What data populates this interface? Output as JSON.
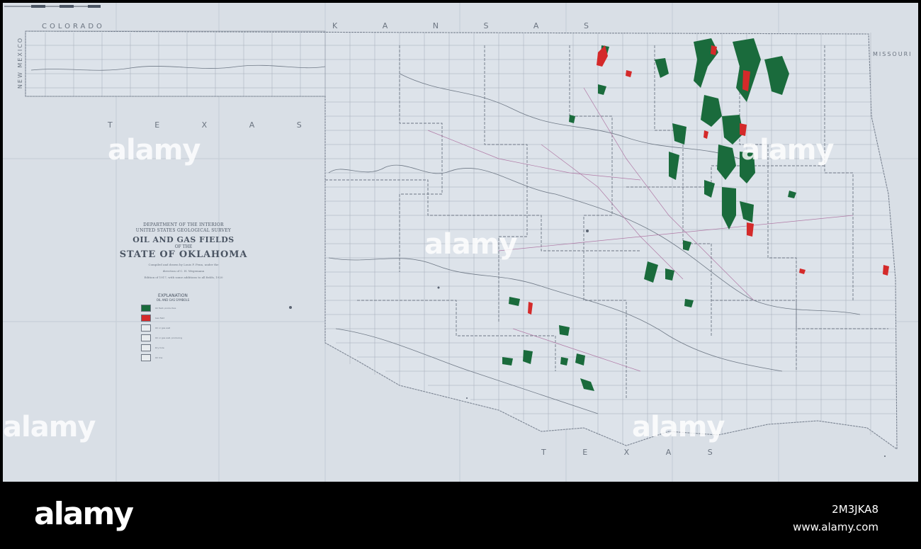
{
  "map": {
    "neighbors": {
      "north_west": "COLORADO",
      "north": "K A N S A S",
      "west_panhandle": "NEW MEXICO",
      "southwest": "T E X A S",
      "south": "T E X A S",
      "east": "MISSOURI"
    },
    "title_block": {
      "department": "DEPARTMENT OF THE INTERIOR",
      "survey": "UNITED STATES GEOLOGICAL SURVEY",
      "title": "OIL AND GAS FIELDS",
      "of_the": "OF THE",
      "state": "STATE OF OKLAHOMA",
      "credit_1": "Compiled and drawn by Louis F. Fenn, under the",
      "credit_2": "direction of C. H. Wegemann",
      "credit_3": "Edition of 1917, with some additions to all fields, 1920"
    },
    "legend": {
      "heading": "EXPLANATION",
      "subheading": "OIL AND GAS SYMBOLS",
      "items": [
        {
          "label": "Oil field, productive",
          "color": "#1a6b3c"
        },
        {
          "label": "Gas field",
          "color": "#d42a2a"
        },
        {
          "label": "Oil or gas well",
          "color": "#e8ecef"
        },
        {
          "label": "Oil or gas well, producing",
          "color": "#e8ecef"
        },
        {
          "label": "Dry hole",
          "color": "#e8ecef"
        },
        {
          "label": "Oil line",
          "color": "#e8ecef"
        }
      ]
    },
    "colors": {
      "oil": "#1a6b3c",
      "gas": "#d42a2a",
      "paper": "#d9dfe6",
      "lines": "#8a93a0",
      "roads": "#b07aa6"
    }
  },
  "watermarks": {
    "text": "alamy"
  },
  "footer": {
    "brand": "alamy",
    "image_id": "2M3JKA8",
    "site": "www.alamy.com"
  }
}
